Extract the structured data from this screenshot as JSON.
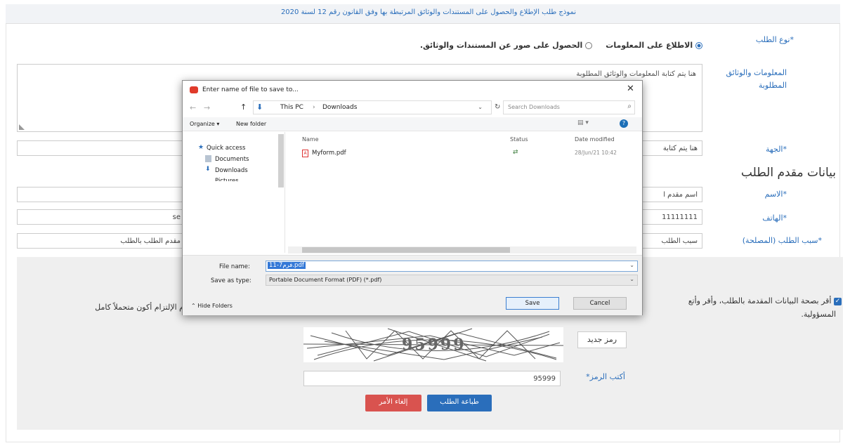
{
  "header": {
    "title": "نموذج طلب الإطلاع والحصول على المستندات والوثائق المرتبطة بها وفق القانون رقم 12 لسنة 2020"
  },
  "form": {
    "request_type_label": "*نوع الطلب",
    "option1": "الاطلاع على المعلومات",
    "option2": "الحصول على صور عن المستندات والوثائق.",
    "info_label": "المعلومات والوثائق المطلوبة",
    "info_placeholder": "هنا يتم كتابة المعلومات والوثائق المطلوبة",
    "entity_label": "*الجهة",
    "entity_value": "هنا يتم كتابة",
    "applicant_heading": "بيانات مقدم الطلب",
    "name_label": "*الاسم",
    "name_value": "اسم مقدم ا",
    "phone_label": "*الهاتف",
    "phone_value": "11111111",
    "phone_value_left": "se",
    "reason_label": "*سبب الطلب (المصلحة)",
    "reason_value": "سبب الطلب",
    "reason_value_left": "مقدم الطلب بالطلب",
    "declaration_right": "أقر بصحة البيانات المقدمة بالطلب، وأقر وأتع",
    "declaration_left": "م الإلتزام أكون متحملاً كامل",
    "declaration_line2": "المسؤولية.",
    "new_code_button": "رمز جديد",
    "captcha_text": "95999",
    "code_label": "أكتب الرمز*",
    "code_value": "95999",
    "print_button": "طباعة الطلب",
    "cancel_button": "إلغاء الأمر"
  },
  "dialog": {
    "title": "Enter name of file to save to...",
    "path": [
      "This PC",
      "Downloads"
    ],
    "search_placeholder": "Search Downloads",
    "organize": "Organize ▾",
    "new_folder": "New folder",
    "nav": [
      "Quick access",
      "Documents",
      "Downloads",
      "Pictures"
    ],
    "columns": [
      "Name",
      "Status",
      "Date modified"
    ],
    "files": [
      {
        "name": "Myform.pdf",
        "status": "⇄",
        "date": "28/Jun/21 10:42"
      }
    ],
    "file_name_label": "File name:",
    "file_name_value": "فرم7-11.pdf",
    "save_type_label": "Save as type:",
    "save_type_value": "Portable Document Format (PDF) (*.pdf)",
    "hide_folders": "Hide Folders",
    "save": "Save",
    "cancel": "Cancel"
  },
  "colors": {
    "blue": "#2a6ebb",
    "red": "#d9534f",
    "panel": "#efefef"
  }
}
